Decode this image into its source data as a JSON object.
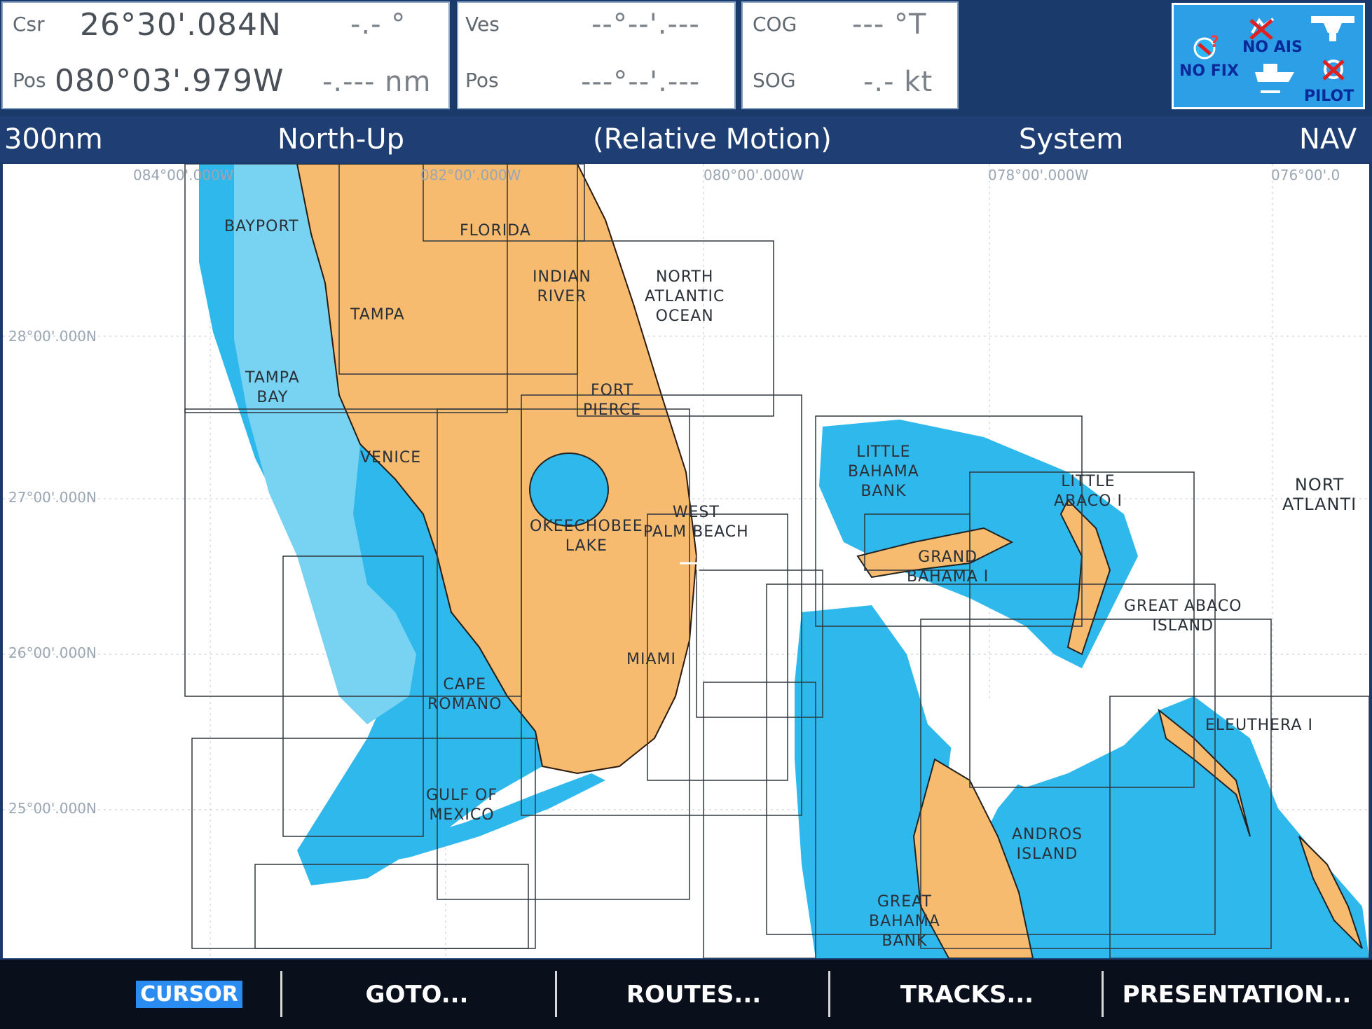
{
  "header": {
    "cursor": {
      "csr_label": "Csr",
      "pos_label": "Pos",
      "lat": "26°30'.084N",
      "lon": "080°03'.979W",
      "bearing": "-.- °",
      "range": "-.--- nm"
    },
    "vessel": {
      "ves_label": "Ves",
      "pos_label": "Pos",
      "lat": "--°--'.---",
      "lon": "---°--'.---"
    },
    "nav": {
      "cog_label": "COG",
      "sog_label": "SOG",
      "cog": "--- °T",
      "sog": "-.- kt"
    },
    "status": {
      "noais": "NO AIS",
      "nofix": "NO FIX",
      "pilot": "PILOT"
    }
  },
  "statusbar": {
    "range": "300nm",
    "orientation": "North-Up",
    "motion": "(Relative Motion)",
    "mode": "System",
    "page": "NAV"
  },
  "chart": {
    "lon_labels": [
      "084°00'.000W",
      "082°00'.000W",
      "080°00'.000W",
      "078°00'.000W",
      "076°00'.0"
    ],
    "lat_labels": [
      "28°00'.000N",
      "27°00'.000N",
      "26°00'.000N",
      "25°00'.000N"
    ],
    "places": {
      "bayport": "BAYPORT",
      "florida": "FLORIDA",
      "indian_river": "INDIAN\nRIVER",
      "north_atlantic": "NORTH\nATLANTIC\nOCEAN",
      "tampa": "TAMPA",
      "tampa_bay": "TAMPA\nBAY",
      "fort_pierce": "FORT\nPIERCE",
      "venice": "VENICE",
      "okeechobee_lake": "OKEECHOBEE\nLAKE",
      "west_palm": "WEST\nPALM BEACH",
      "cape_romano": "CAPE\nROMANO",
      "miami": "MIAMI",
      "gulf_mexico": "GULF OF\nMEXICO",
      "little_bahama": "LITTLE\nBAHAMA\nBANK",
      "grand_bahama": "GRAND\nBAHAMA I",
      "little_abaco": "LITTLE\nABACO I",
      "great_abaco": "GREAT ABACO\nISLAND",
      "eleuthera": "ELEUTHERA I",
      "andros": "ANDROS\nISLAND",
      "great_bahama_bank": "GREAT\nBAHAMA\nBANK",
      "north_atlantic_2": "NORT\nATLANTI"
    }
  },
  "softkeys": [
    "CURSOR",
    "GOTO...",
    "ROUTES...",
    "TRACKS...",
    "PRESENTATION..."
  ],
  "colors": {
    "land": "#f7bb6f",
    "shallow": "#2fb8ec",
    "medium": "#78d2f2",
    "deep": "#ffffff",
    "header_bg": "#1a3a6c"
  }
}
